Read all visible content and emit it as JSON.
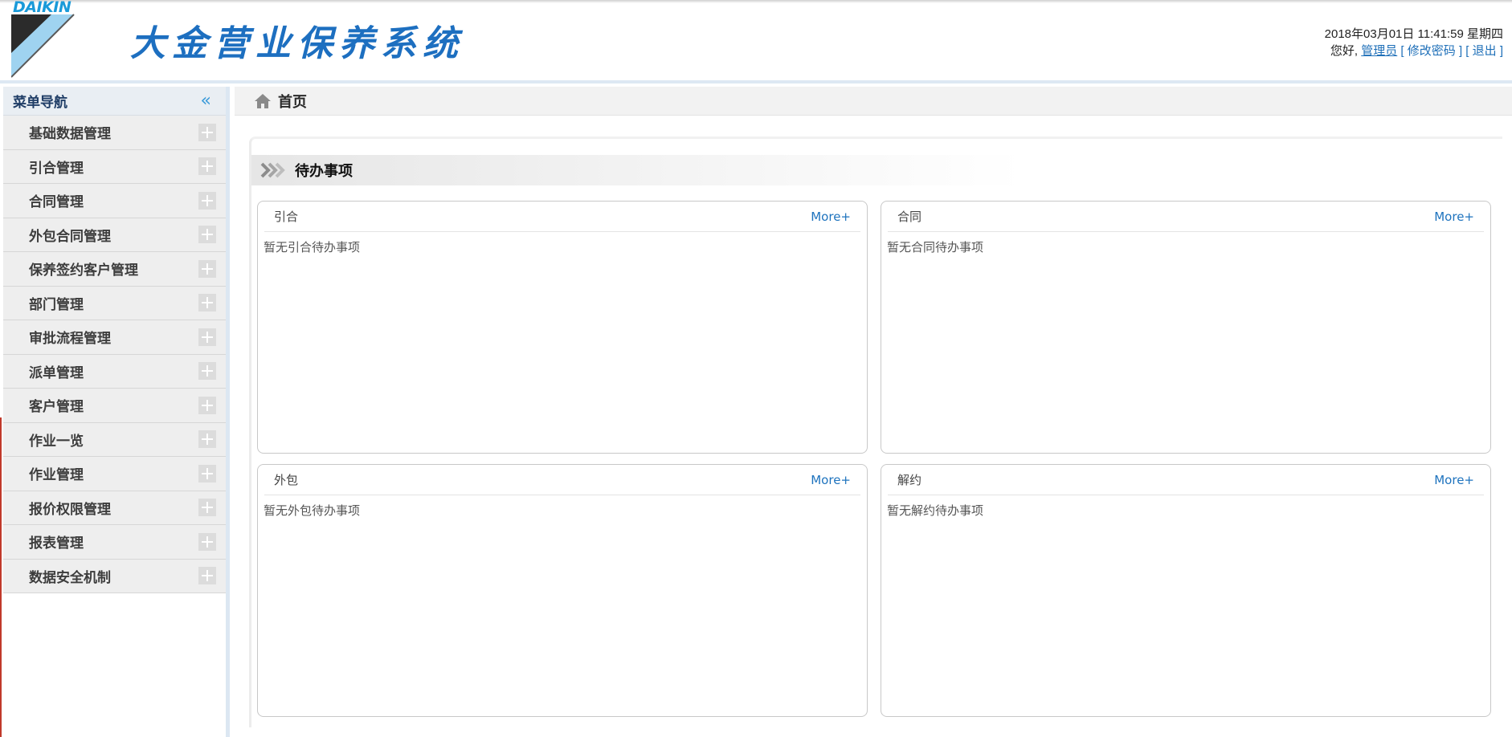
{
  "header": {
    "logo_text": "DAIKIN",
    "app_title": "大金营业保养系统",
    "datetime": "2018年03月01日 11:41:59 星期四",
    "greeting": "您好,",
    "user_link": "管理员",
    "change_password": "修改密码",
    "logout": "退出",
    "bracket_open": "[",
    "bracket_close": "]"
  },
  "sidebar": {
    "title": "菜单导航",
    "collapse_glyph": "«",
    "items": [
      {
        "label": "基础数据管理"
      },
      {
        "label": "引合管理"
      },
      {
        "label": "合同管理"
      },
      {
        "label": "外包合同管理"
      },
      {
        "label": "保养签约客户管理"
      },
      {
        "label": "部门管理"
      },
      {
        "label": "审批流程管理"
      },
      {
        "label": "派单管理"
      },
      {
        "label": "客户管理"
      },
      {
        "label": "作业一览"
      },
      {
        "label": "作业管理"
      },
      {
        "label": "报价权限管理"
      },
      {
        "label": "报表管理"
      },
      {
        "label": "数据安全机制"
      }
    ]
  },
  "breadcrumb": {
    "home": "首页"
  },
  "todo": {
    "section_title": "待办事项",
    "cards": [
      {
        "title": "引合",
        "more": "More+",
        "empty": "暂无引合待办事项"
      },
      {
        "title": "合同",
        "more": "More+",
        "empty": "暂无合同待办事项"
      },
      {
        "title": "外包",
        "more": "More+",
        "empty": "暂无外包待办事项"
      },
      {
        "title": "解约",
        "more": "More+",
        "empty": "暂无解约待办事项"
      }
    ]
  },
  "colors": {
    "brand_blue": "#1d6fc0",
    "link_blue": "#1e73be",
    "sidebar_bg": "#eeeeee",
    "accent_blue": "#3a9ad9"
  }
}
